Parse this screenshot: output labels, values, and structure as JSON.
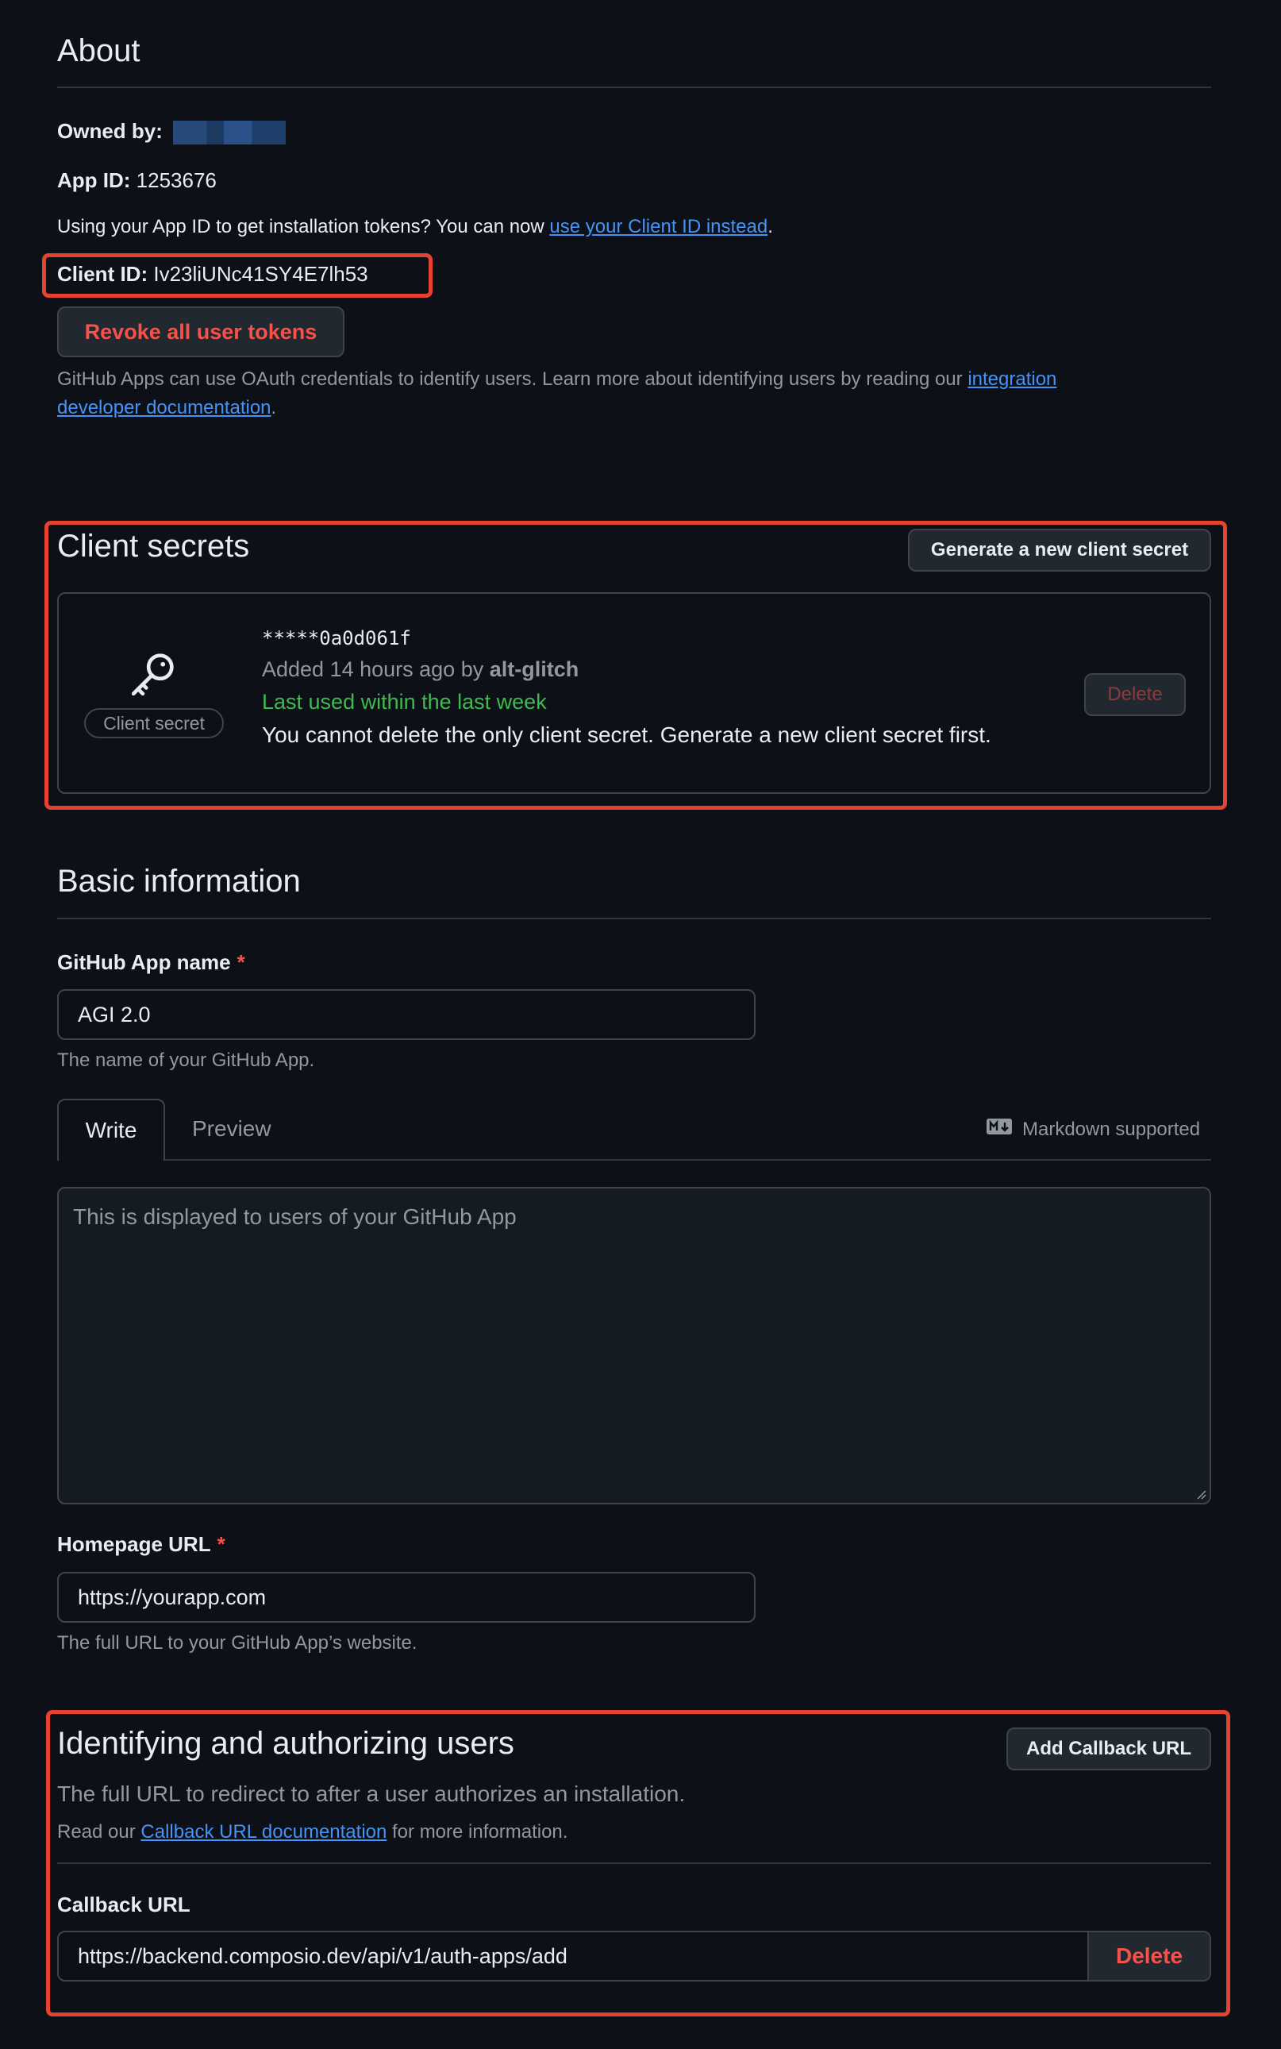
{
  "about": {
    "title": "About",
    "owned_by_label": "Owned by:",
    "app_id_label": "App ID:",
    "app_id_value": "1253676",
    "notice_prefix": "Using your App ID to get installation tokens? You can now",
    "notice_link": "use your Client ID instead",
    "notice_suffix": ".",
    "client_id_label": "Client ID:",
    "client_id_value": "Iv23liUNc41SY4E7lh53",
    "revoke_button": "Revoke all user tokens",
    "oauth_text": "GitHub Apps can use OAuth credentials to identify users. Learn more about identifying users by reading our",
    "oauth_link_1": "integration",
    "oauth_link_2": "developer documentation",
    "oauth_suffix": "."
  },
  "client_secrets": {
    "title": "Client secrets",
    "generate_button": "Generate a new client secret",
    "secret_badge": "Client secret",
    "secret_value": "*****0a0d061f",
    "added_prefix": "Added 14 hours ago by",
    "added_by": "alt-glitch",
    "last_used": "Last used within the last week",
    "warning": "You cannot delete the only client secret. Generate a new client secret first.",
    "delete_button": "Delete"
  },
  "basic": {
    "title": "Basic information",
    "app_name_label": "GitHub App name",
    "required_marker": "*",
    "app_name_value": "AGI 2.0",
    "app_name_hint": "The name of your GitHub App.",
    "tab_write": "Write",
    "tab_preview": "Preview",
    "markdown_label": "Markdown supported",
    "description_placeholder": "This is displayed to users of your GitHub App",
    "homepage_label": "Homepage URL",
    "homepage_value": "https://yourapp.com",
    "homepage_hint": "The full URL to your GitHub App’s website."
  },
  "auth": {
    "title": "Identifying and authorizing users",
    "add_callback_button": "Add Callback URL",
    "description": "The full URL to redirect to after a user authorizes an installation.",
    "read_prefix": "Read our",
    "read_link": "Callback URL documentation",
    "read_suffix": "for more information.",
    "callback_label": "Callback URL",
    "callback_value": "https://backend.composio.dev/api/v1/auth-apps/add",
    "delete_button": "Delete"
  },
  "colors": {
    "background": "#0d1117",
    "accent_link": "#4493f8",
    "danger": "#f85149",
    "success": "#3fb950",
    "highlight": "#e5432f"
  }
}
